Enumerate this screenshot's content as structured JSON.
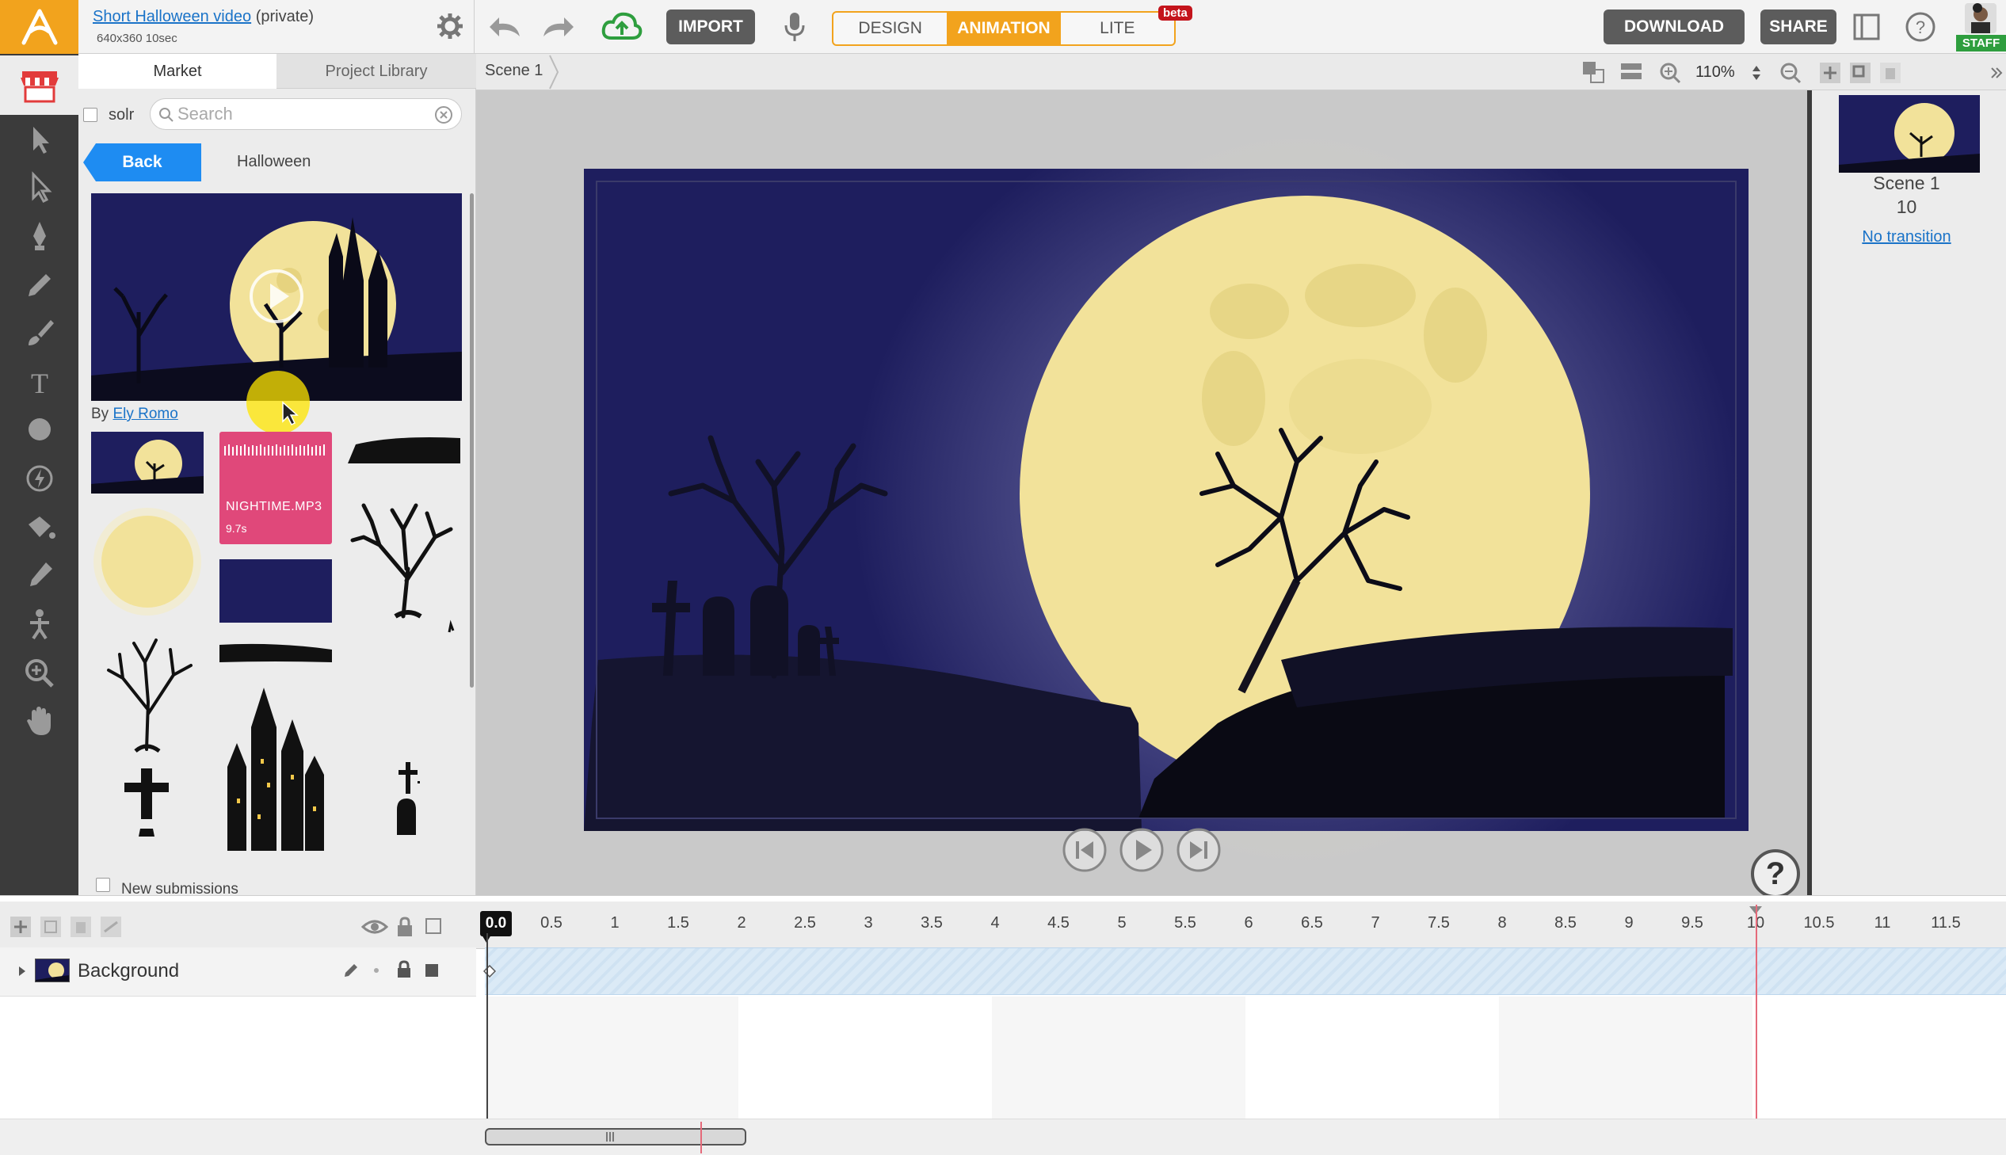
{
  "app": {
    "project_title": "Short Halloween video",
    "privacy": "(private)",
    "meta": "640x360  10sec"
  },
  "toolbar": {
    "import_label": "IMPORT",
    "modes": [
      "DESIGN",
      "ANIMATION",
      "LITE"
    ],
    "active_mode": "ANIMATION",
    "beta_label": "beta",
    "download_label": "DOWNLOAD",
    "share_label": "SHARE",
    "staff_label": "STAFF"
  },
  "market": {
    "tabs": [
      "Market",
      "Project Library"
    ],
    "filter_label": "solr",
    "search_placeholder": "Search",
    "back_label": "Back",
    "breadcrumb": "Halloween",
    "by_label": "By",
    "author": "Ely Romo",
    "audio_item": {
      "name": "NIGHTIME.MP3",
      "duration": "9.7s"
    },
    "new_submissions_label": "New submissions"
  },
  "scene_bar": {
    "scene_label": "Scene 1",
    "zoom": "110%"
  },
  "right_panel": {
    "scene_name": "Scene 1",
    "scene_duration": "10",
    "transition_label": "No transition"
  },
  "timeline": {
    "playhead": "0.0",
    "ticks": [
      "0.5",
      "1",
      "1.5",
      "2",
      "2.5",
      "3",
      "3.5",
      "4",
      "4.5",
      "5",
      "5.5",
      "6",
      "6.5",
      "7",
      "7.5",
      "8",
      "8.5",
      "9",
      "9.5",
      "10",
      "10.5",
      "11",
      "11.5"
    ],
    "layer_name": "Background"
  },
  "colors": {
    "accent": "#f2a31d",
    "link": "#1a73c8",
    "dark": "#3b3b3b",
    "audio": "#e0487a",
    "night": "#1e1e5e",
    "moon": "#f2e29a"
  }
}
